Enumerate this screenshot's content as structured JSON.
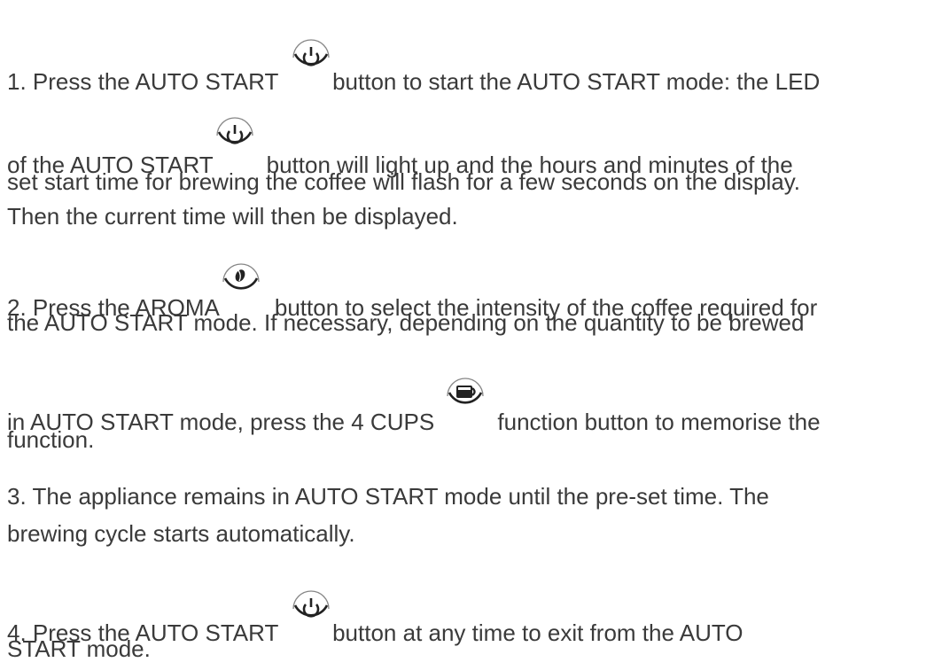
{
  "steps": [
    {
      "lines": [
        [
          "1. Press the AUTO START ",
          "button to start the AUTO START mode: the LED"
        ],
        [
          "of the AUTO START",
          "button will light up and the hours and minutes of the"
        ],
        [
          "set start time for brewing the coffee will flash for a few seconds on the display."
        ],
        [
          "Then the current time will then be displayed."
        ]
      ]
    },
    {
      "lines": [
        [
          "2. Press the AROMA",
          "button to select the intensity of the coffee required for"
        ],
        [
          "the AUTO START mode. If necessary, depending on the quantity to be brewed"
        ],
        [
          "in AUTO START mode, press the 4 CUPS ",
          "function button to memorise the"
        ],
        [
          "function."
        ]
      ]
    },
    {
      "lines": [
        [
          "3. The appliance remains in AUTO START mode until the pre-set time. The"
        ],
        [
          "brewing cycle starts automatically."
        ]
      ]
    },
    {
      "lines": [
        [
          "4. Press the AUTO START ",
          "button at any time to exit from the AUTO"
        ],
        [
          "START mode."
        ]
      ]
    }
  ],
  "icons": {
    "auto_start": "power-clock-icon",
    "aroma": "coffee-bean-icon",
    "four_cups": "coffee-pot-icon"
  },
  "colors": {
    "text": "#3a3a3a",
    "icon_stroke": "#222222"
  }
}
